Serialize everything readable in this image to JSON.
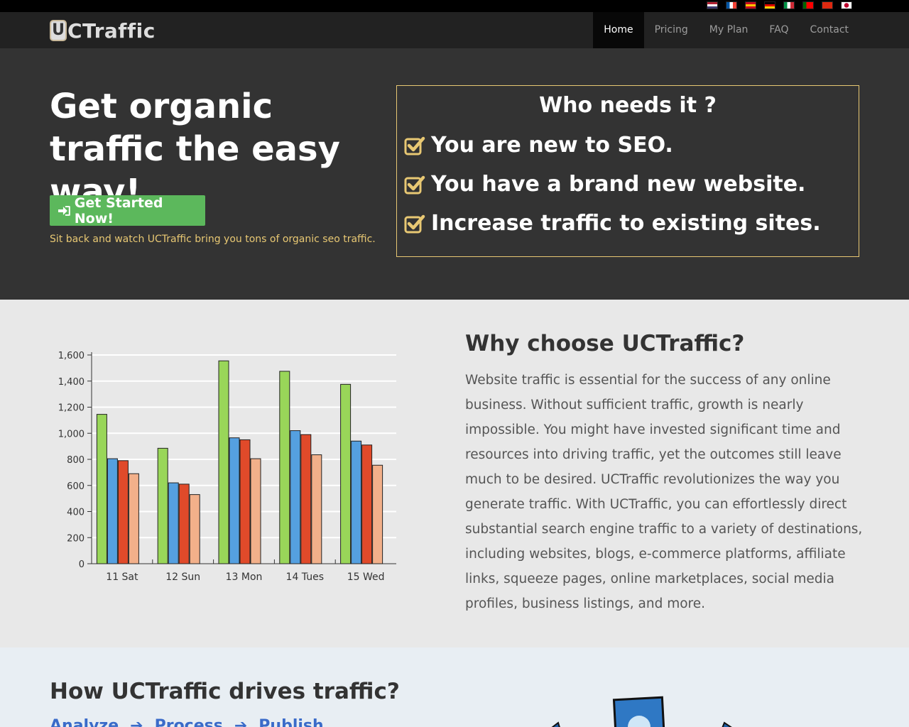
{
  "flags": [
    {
      "name": "us-flag-icon",
      "colors": [
        "#b22234",
        "#ffffff",
        "#3c3b6e"
      ]
    },
    {
      "name": "france-flag-icon",
      "colors": [
        "#0055a4",
        "#ffffff",
        "#ef4135"
      ]
    },
    {
      "name": "spain-flag-icon",
      "colors": [
        "#c60b1e",
        "#ffc400",
        "#c60b1e"
      ]
    },
    {
      "name": "germany-flag-icon",
      "colors": [
        "#000000",
        "#dd0000",
        "#ffce00"
      ]
    },
    {
      "name": "italy-flag-icon",
      "colors": [
        "#009246",
        "#ffffff",
        "#ce2b37"
      ]
    },
    {
      "name": "portugal-flag-icon",
      "colors": [
        "#006600",
        "#ff0000",
        "#ff0000"
      ]
    },
    {
      "name": "china-flag-icon",
      "colors": [
        "#de2910",
        "#de2910",
        "#de2910"
      ]
    },
    {
      "name": "japan-flag-icon",
      "colors": [
        "#ffffff",
        "#bc002d",
        "#ffffff"
      ]
    }
  ],
  "logo": {
    "badge": "U",
    "text": "CTraffic"
  },
  "nav": {
    "items": [
      {
        "label": "Home",
        "active": true
      },
      {
        "label": "Pricing",
        "active": false
      },
      {
        "label": "My Plan",
        "active": false
      },
      {
        "label": "FAQ",
        "active": false
      },
      {
        "label": "Contact",
        "active": false
      }
    ]
  },
  "hero": {
    "title": "Get organic traffic the easy way!",
    "cta_label": "Get Started Now!",
    "subtitle": "Sit back and watch UCTraffic bring you tons of organic seo traffic."
  },
  "who": {
    "title": "Who needs it ?",
    "items": [
      "You are new to SEO.",
      "You have a brand new website.",
      "Increase traffic to existing sites."
    ]
  },
  "why": {
    "title": "Why choose UCTraffic?",
    "text": "Website traffic is essential for the success of any online business. Without sufficient traffic, growth is nearly impossible. You might have invested significant time and resources into driving traffic, yet the outcomes still leave much to be desired. UCTraffic revolutionizes the way you generate traffic. With UCTraffic, you can effortlessly direct substantial search engine traffic to a variety of destinations, including websites, blogs, e-commerce platforms, affiliate links, squeeze pages, online marketplaces, social media profiles, business listings, and more."
  },
  "how": {
    "title": "How UCTraffic drives traffic?",
    "steps": [
      "Analyze",
      "Process",
      "Publish"
    ]
  },
  "chart_data": {
    "type": "bar",
    "categories": [
      "11 Sat",
      "12 Sun",
      "13 Mon",
      "14 Tues",
      "15 Wed"
    ],
    "series": [
      {
        "color": "#99d659",
        "values": [
          1145,
          885,
          1555,
          1475,
          1375
        ]
      },
      {
        "color": "#55a0e0",
        "values": [
          805,
          620,
          965,
          1020,
          940
        ]
      },
      {
        "color": "#e04a2a",
        "values": [
          790,
          610,
          950,
          990,
          910
        ]
      },
      {
        "color": "#f2b08a",
        "values": [
          690,
          530,
          805,
          835,
          755
        ]
      }
    ],
    "ylim": [
      0,
      1600
    ],
    "yticks": [
      0,
      200,
      400,
      600,
      800,
      1000,
      1200,
      1400,
      1600
    ],
    "ytick_labels": [
      "0",
      "200",
      "400",
      "600",
      "800",
      "1,000",
      "1,200",
      "1,400",
      "1,600"
    ],
    "grid": true
  },
  "colors": {
    "accent_gold": "#e8c873",
    "cta_green": "#5cb85c",
    "link_blue": "#3a6bc9"
  }
}
